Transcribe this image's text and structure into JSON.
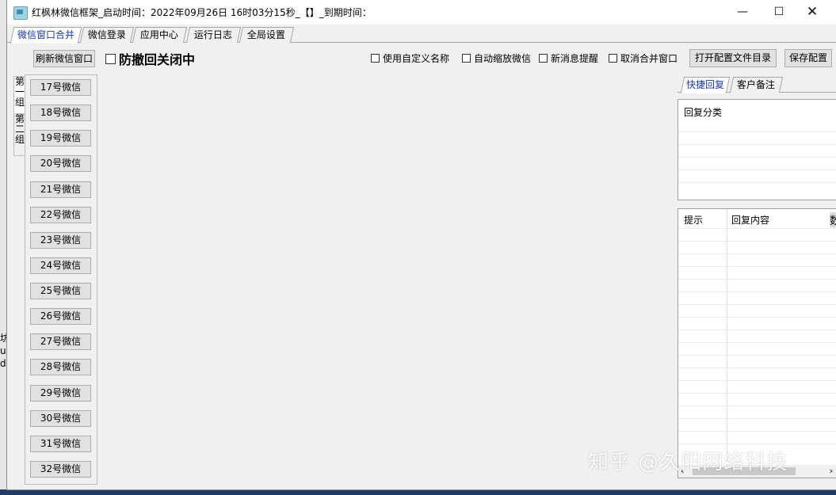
{
  "window": {
    "title": "红枫林微信框架_启动时间：2022年09月26日 16时03分15秒_【】_到期时间："
  },
  "tabs": [
    "微信窗口合并",
    "微信登录",
    "应用中心",
    "运行日志",
    "全局设置"
  ],
  "toolbar": {
    "refresh_label": "刷新微信窗口",
    "anti_recall_label": "防撤回关闭中",
    "use_custom_name_label": "使用自定义名称",
    "auto_zoom_label": "自动缩放微信",
    "new_msg_label": "新消息提醒",
    "cancel_merge_label": "取消合并窗口",
    "open_config_dir_label": "打开配置文件目录",
    "save_config_label": "保存配置"
  },
  "groups": {
    "tab1": "第一组",
    "tab2": "第二组"
  },
  "wechat_buttons": [
    "17号微信",
    "18号微信",
    "19号微信",
    "20号微信",
    "21号微信",
    "22号微信",
    "23号微信",
    "24号微信",
    "25号微信",
    "26号微信",
    "27号微信",
    "28号微信",
    "29号微信",
    "30号微信",
    "31号微信",
    "32号微信"
  ],
  "right_tabs": [
    "快捷回复",
    "客户备注"
  ],
  "reply_category": {
    "header": "回复分类"
  },
  "reply_table": {
    "columns": [
      "提示",
      "回复内容"
    ]
  },
  "watermark": "知乎 @久阳网络科技",
  "edge_text": {
    "side_right": "数",
    "left_bg": [
      "坊",
      "u",
      "di"
    ]
  }
}
